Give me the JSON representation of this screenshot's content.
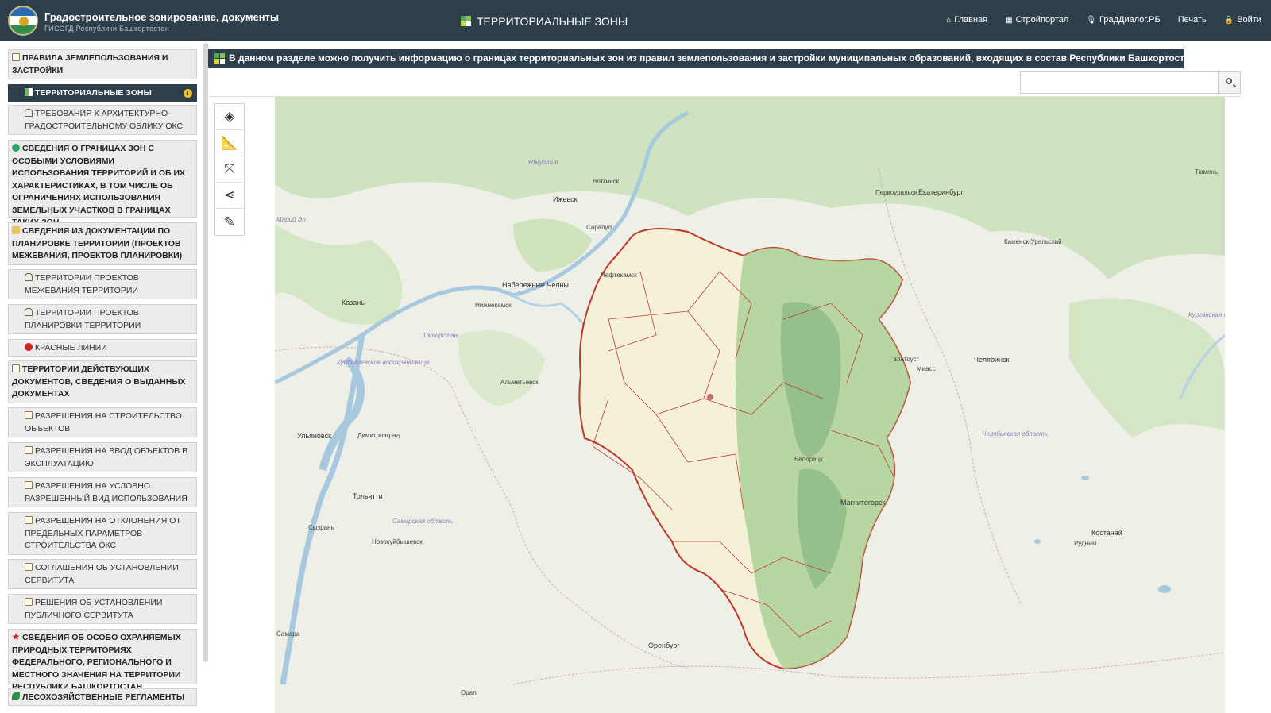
{
  "header": {
    "title": "Градостроительное зонирование, документы",
    "subtitle": "ГИСОГД Республики Башкортостан",
    "page_title": "ТЕРРИТОРИАЛЬНЫЕ ЗОНЫ",
    "nav": [
      {
        "label": "Главная",
        "icon": "home-icon"
      },
      {
        "label": "Стройпортал",
        "icon": "building-icon"
      },
      {
        "label": "ГрадДиалог.РБ",
        "icon": "mic-icon"
      },
      {
        "label": "Печать",
        "icon": ""
      },
      {
        "label": "Войти",
        "icon": "lock-icon"
      }
    ]
  },
  "sidebar": {
    "items": [
      {
        "label": "ПРАВИЛА ЗЕМЛЕПОЛЬЗОВАНИЯ И ЗАСТРОЙКИ",
        "icon": "doc-icon"
      },
      {
        "label": "ТЕРРИТОРИАЛЬНЫЕ ЗОНЫ",
        "icon": "zone-icon",
        "badge": "i"
      },
      {
        "label": "ТРЕБОВАНИЯ К АРХИТЕКТУРНО-ГРАДОСТРОИТЕЛЬНОМУ ОБЛИКУ ОКС",
        "icon": "house-icon"
      },
      {
        "label": "СВЕДЕНИЯ О ГРАНИЦАХ ЗОН С ОСОБЫМИ УСЛОВИЯМИ ИСПОЛЬЗОВАНИЯ ТЕРРИТОРИЙ И ОБ ИХ ХАРАКТЕРИСТИКАХ, В ТОМ ЧИСЛЕ ОБ ОГРАНИЧЕНИЯХ ИСПОЛЬЗОВАНИЯ ЗЕМЕЛЬНЫХ УЧАСТКОВ В ГРАНИЦАХ ТАКИХ ЗОН",
        "icon": "globe-icon"
      },
      {
        "label": "СВЕДЕНИЯ ИЗ ДОКУМЕНТАЦИИ ПО ПЛАНИРОВКЕ ТЕРРИТОРИИ (ПРОЕКТОВ МЕЖЕВАНИЯ, ПРОЕКТОВ ПЛАНИРОВКИ)",
        "icon": "folder-icon"
      },
      {
        "label": "ТЕРРИТОРИИ ПРОЕКТОВ МЕЖЕВАНИЯ ТЕРРИТОРИИ",
        "icon": "house-icon"
      },
      {
        "label": "ТЕРРИТОРИИ ПРОЕКТОВ ПЛАНИРОВКИ ТЕРРИТОРИИ",
        "icon": "house-icon"
      },
      {
        "label": "КРАСНЫЕ ЛИНИИ",
        "icon": "red-dot-icon"
      },
      {
        "label": "ТЕРРИТОРИИ ДЕЙСТВУЮЩИХ ДОКУМЕНТОВ, СВЕДЕНИЯ О ВЫДАННЫХ ДОКУМЕНТАХ",
        "icon": "doc-icon"
      },
      {
        "label": "РАЗРЕШЕНИЯ НА СТРОИТЕЛЬСТВО ОБЪЕКТОВ",
        "icon": "doc-icon"
      },
      {
        "label": "РАЗРЕШЕНИЯ НА ВВОД ОБЪЕКТОВ В ЭКСПЛУАТАЦИЮ",
        "icon": "doc-icon"
      },
      {
        "label": "РАЗРЕШЕНИЯ НА УСЛОВНО РАЗРЕШЕННЫЙ ВИД ИСПОЛЬЗОВАНИЯ",
        "icon": "doc-icon"
      },
      {
        "label": "РАЗРЕШЕНИЯ НА ОТКЛОНЕНИЯ ОТ ПРЕДЕЛЬНЫХ ПАРАМЕТРОВ СТРОИТЕЛЬСТВА ОКС",
        "icon": "doc-icon"
      },
      {
        "label": "СОГЛАШЕНИЯ ОБ УСТАНОВЛЕНИИ СЕРВИТУТА",
        "icon": "doc-icon"
      },
      {
        "label": "РЕШЕНИЯ ОБ УСТАНОВЛЕНИИ ПУБЛИЧНОГО СЕРВИТУТА",
        "icon": "doc-icon"
      },
      {
        "label": "СВЕДЕНИЯ ОБ ОСОБО ОХРАНЯЕМЫХ ПРИРОДНЫХ ТЕРРИТОРИЯХ ФЕДЕРАЛЬНОГО, РЕГИОНАЛЬНОГО И МЕСТНОГО ЗНАЧЕНИЯ НА ТЕРРИТОРИИ РЕСПУБЛИКИ БАШКОРТОСТАН",
        "icon": "star-icon"
      },
      {
        "label": "ЛЕСОХОЗЯЙСТВЕННЫЕ РЕГЛАМЕНТЫ",
        "icon": "leaf-icon"
      }
    ]
  },
  "main": {
    "banner": "В данном разделе можно получить информацию о границах территориальных зон из правил землепользования и застройки муниципальных образований, входящих в состав Республики Башкортостан.",
    "search": {
      "value": "",
      "placeholder": ""
    },
    "tools": [
      "layers-icon",
      "measure-icon",
      "fullscreen-icon",
      "share-icon",
      "edit-icon"
    ]
  },
  "map": {
    "labels": [
      "Ижевск",
      "Воткинск",
      "Удмуртия",
      "Сарапул",
      "Набережные Челны",
      "Нижнекамск",
      "Казань",
      "Татарстан",
      "Куйбышевское водохранилище",
      "Альметьевск",
      "Нефтекамск",
      "Ульяновск",
      "Димитровград",
      "Тольятти",
      "Самарская область",
      "Сызрань",
      "Новокуйбышевск",
      "Оренбург",
      "Орал",
      "Екатеринбург",
      "Первоуральск",
      "Каменск-Уральский",
      "Тюмень",
      "Курганская область",
      "Златоуст",
      "Миасс",
      "Челябинск",
      "Челябинская область",
      "Магнитогорск",
      "Костанай",
      "Рудный",
      "Белорецк",
      "Марий Эл",
      "Самара"
    ]
  },
  "colors": {
    "header_bg": "#2e3f4c",
    "forest": "#c9e0b8",
    "region_fill": "#f5f1d8",
    "region_border": "#c0392b",
    "water": "#a8c8e0"
  }
}
